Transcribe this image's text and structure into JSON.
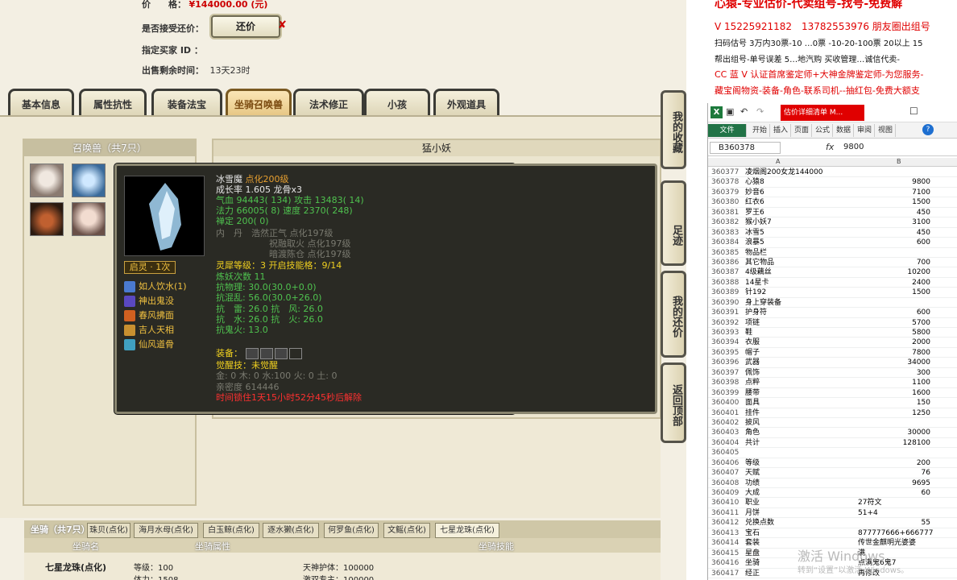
{
  "listing": {
    "price_label": "价　　格：",
    "price_value": "¥144000.00 (元)",
    "counter_label": "是否接受还价：",
    "counter_button": "还价",
    "counter_x": "✘",
    "buyer_label": "指定买家 ID ：",
    "time_label": "出售剩余时间：",
    "time_value": "13天23时"
  },
  "tabs": [
    "基本信息",
    "属性抗性",
    "装备法宝",
    "坐骑召唤兽",
    "法术修正",
    "小孩",
    "外观道具"
  ],
  "summon": {
    "title": "召唤兽（共7只）",
    "right_title": "猛小妖"
  },
  "pet": {
    "name": "冰雪魔",
    "name_tag": "点化200级",
    "growth": "成长率 1.605 龙骨x3",
    "hp": "气血 94443( 134)",
    "atk": "攻击 13483( 14)",
    "mp": "法力 66005( 8)",
    "spd": "速度 2370( 248)",
    "zen": "禅定 200( 0)",
    "dan_label": "内　丹",
    "dan1": "浩然正气 点化197级",
    "dan2": "祝融取火 点化197级",
    "dan3": "暗渡陈仓 点化197级",
    "awaken": "启灵 · 1次",
    "lingxi": "灵犀等级：3 开启技能格：9/14",
    "refine": "炼妖次数 11",
    "res_phys": "抗物理: 30.0(30.0+0.0)",
    "res_chaos": "抗混乱: 56.0(30.0+26.0)",
    "res_line1": "抗　雷: 26.0 抗　风: 26.0",
    "res_line2": "抗　水: 26.0 抗　火: 26.0",
    "res_ghost": "抗鬼火: 13.0",
    "equip_label": "装备：",
    "awaken_skill": "觉醒技：未觉醒",
    "elements": "金: 0 木: 0 水:100 火: 0 土: 0",
    "intimacy": "亲密度 614446",
    "lock": "时间锁住1天15小时52分45秒后解除",
    "skills": [
      "如人饮水(1)",
      "神出鬼没",
      "春风拂面",
      "吉人天相",
      "仙风道骨"
    ]
  },
  "side_buttons": [
    "我的收藏",
    "足迹",
    "我的还价",
    "返回顶部"
  ],
  "mounts": {
    "title": "坐骑（共7只）",
    "tabs": [
      "珠贝(点化)",
      "海月水母(点化)",
      "白玉鲸(点化)",
      "逐水獭(点化)",
      "何罗鱼(点化)",
      "文鳐(点化)",
      "七星龙珠(点化)"
    ],
    "head_name": "坐骑名",
    "head_attr": "坐骑属性",
    "head_skill": "坐骑技能",
    "name": "七星龙珠(点化)",
    "level": "等级：100",
    "body": "体力：1508",
    "skill1": "天神护体：100000",
    "skill2": "激双专主：100000"
  },
  "ads": {
    "line1": "心猿-专业估价-代卖组号-找号-免费解",
    "line2": "V 15225921182　13782553976 朋友圈出组号",
    "line3": "扫码估号 3万内30票-10 …0票 -10-20-100票 20以上 15",
    "line4": "帮出组号-单号误差 5…地汽购 买收管理…诚信代卖-",
    "line5": "CC 蓝 V 认证首席鉴定师+大神金牌鉴定师-为您服务-",
    "line6": "藏宝阁物资-装备-角色-联系司机--抽红包-免费大额支"
  },
  "excel": {
    "title": "估价详细清单 M...",
    "ribbon": [
      "文件",
      "开始",
      "插入",
      "页面",
      "公式",
      "数据",
      "审阅",
      "视图"
    ],
    "name_box": "B360378",
    "formula_value": "9800",
    "col_a": "A",
    "col_b": "B",
    "rows": [
      [
        "360377",
        "凌烟阁200女龙144000",
        ""
      ],
      [
        "360378",
        "心猿8",
        "9800"
      ],
      [
        "360379",
        "妙音6",
        "7100"
      ],
      [
        "360380",
        "红衣6",
        "1500"
      ],
      [
        "360381",
        "罗王6",
        "450"
      ],
      [
        "360382",
        "猴小妖7",
        "3100"
      ],
      [
        "360383",
        "冰雪5",
        "450"
      ],
      [
        "360384",
        "浪暴5",
        "600"
      ],
      [
        "360385",
        "物品栏",
        ""
      ],
      [
        "360386",
        "其它物品",
        "700"
      ],
      [
        "360387",
        "4级藕丝",
        "10200"
      ],
      [
        "360388",
        "14星卡",
        "2400"
      ],
      [
        "360389",
        "针192",
        "1500"
      ],
      [
        "360390",
        "身上穿装备",
        ""
      ],
      [
        "360391",
        "护身符",
        "600"
      ],
      [
        "360392",
        "项链",
        "5700"
      ],
      [
        "360393",
        "鞋",
        "5800"
      ],
      [
        "360394",
        "衣服",
        "2000"
      ],
      [
        "360395",
        "帽子",
        "7800"
      ],
      [
        "360396",
        "武器",
        "34000"
      ],
      [
        "360397",
        "佩饰",
        "300"
      ],
      [
        "360398",
        "点粹",
        "1100"
      ],
      [
        "360399",
        "腰带",
        "1600"
      ],
      [
        "360400",
        "面具",
        "150"
      ],
      [
        "360401",
        "挂件",
        "1250"
      ],
      [
        "360402",
        "披风",
        ""
      ],
      [
        "360403",
        "角色",
        "30000"
      ],
      [
        "360404",
        "共计",
        "128100"
      ],
      [
        "360405",
        "",
        ""
      ],
      [
        "360406",
        "等级",
        "200"
      ],
      [
        "360407",
        "天赋",
        "76"
      ],
      [
        "360408",
        "功绩",
        "9695"
      ],
      [
        "360409",
        "大成",
        "60"
      ],
      [
        "360410",
        "职业",
        "27符文"
      ],
      [
        "360411",
        "月饼",
        "51+4"
      ],
      [
        "360412",
        "兑换点数",
        "55"
      ],
      [
        "360413",
        "宝石",
        "877777666+666777"
      ],
      [
        "360414",
        "套装",
        "传世金麒明光婆婆"
      ],
      [
        "360415",
        "星盘",
        "满"
      ],
      [
        "360416",
        "坐骑",
        "点满鬼6鬼7"
      ],
      [
        "360417",
        "经正",
        "再修改"
      ]
    ]
  },
  "watermark": {
    "line1": "激活 Windows",
    "line2": "转到“设置”以激活 Windows。"
  }
}
